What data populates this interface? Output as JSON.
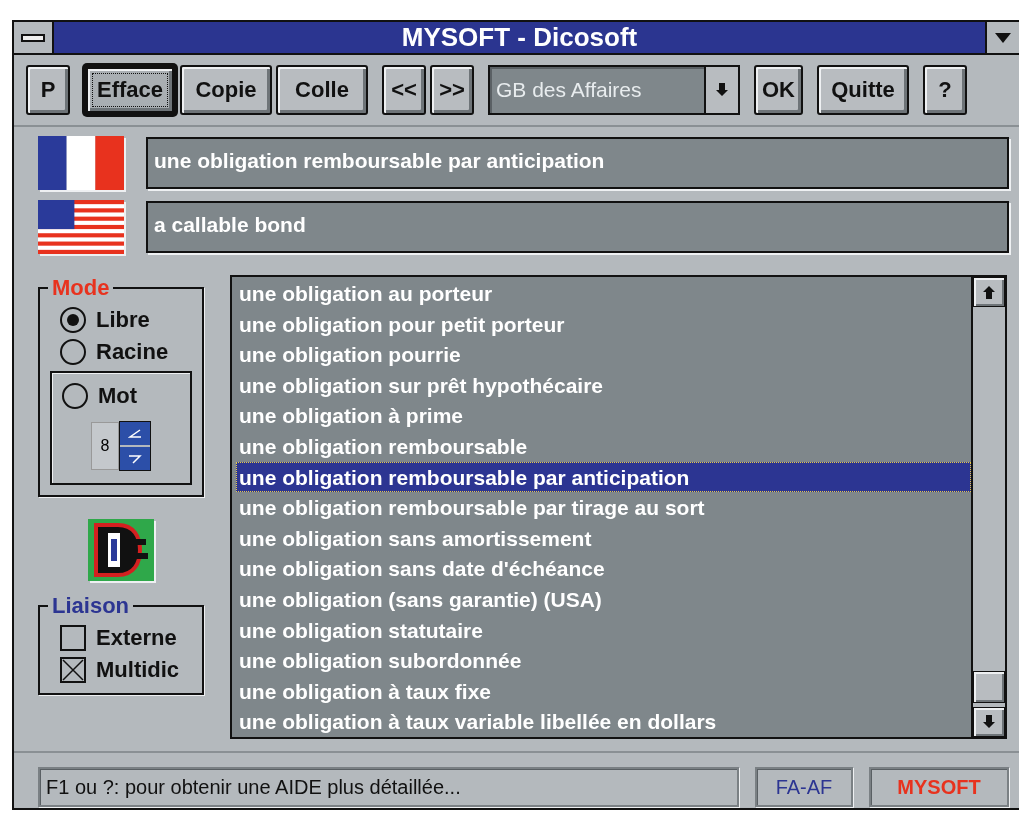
{
  "window": {
    "title": "MYSOFT - Dicosoft"
  },
  "toolbar": [
    {
      "kind": "button",
      "label": "P",
      "focused": false
    },
    {
      "kind": "button",
      "label": "Efface",
      "focused": true
    },
    {
      "kind": "button",
      "label": "Copie",
      "focused": false
    },
    {
      "kind": "button",
      "label": "Colle",
      "focused": false
    },
    {
      "kind": "button",
      "label": "<<",
      "focused": false
    },
    {
      "kind": "button",
      "label": ">>",
      "focused": false
    },
    {
      "kind": "select",
      "value": "GB des Affaires"
    },
    {
      "kind": "button",
      "label": "OK",
      "focused": false
    },
    {
      "kind": "button",
      "label": "Quitte",
      "focused": false
    },
    {
      "kind": "button",
      "label": "?",
      "focused": false
    }
  ],
  "translations": [
    {
      "kind": "french",
      "text": "une obligation remboursable par anticipation"
    },
    {
      "kind": "american",
      "text": "a callable bond"
    }
  ],
  "mode": {
    "title": "Mode",
    "options": [
      {
        "label": "Libre",
        "selected": true
      },
      {
        "label": "Racine",
        "selected": false
      },
      {
        "label": "Mot",
        "selected": false
      }
    ],
    "word_count": "8"
  },
  "liaison": {
    "title": "Liaison",
    "options": [
      {
        "label": "Externe",
        "checked": false
      },
      {
        "label": "Multidic",
        "checked": true
      }
    ]
  },
  "results": [
    {
      "text": "une obligation au porteur",
      "selected": false
    },
    {
      "text": "une obligation pour petit porteur",
      "selected": false
    },
    {
      "text": "une obligation pourrie",
      "selected": false
    },
    {
      "text": "une obligation sur prêt hypothécaire",
      "selected": false
    },
    {
      "text": "une obligation à prime",
      "selected": false
    },
    {
      "text": "une obligation remboursable",
      "selected": false
    },
    {
      "text": "une obligation remboursable par anticipation",
      "selected": true
    },
    {
      "text": "une obligation remboursable par tirage au sort",
      "selected": false
    },
    {
      "text": "une obligation sans amortissement",
      "selected": false
    },
    {
      "text": "une obligation sans date d'échéance",
      "selected": false
    },
    {
      "text": "une obligation (sans garantie) (USA)",
      "selected": false
    },
    {
      "text": "une obligation statutaire",
      "selected": false
    },
    {
      "text": "une obligation subordonnée",
      "selected": false
    },
    {
      "text": "une obligation à taux fixe",
      "selected": false
    },
    {
      "text": "une obligation à taux variable libellée en dollars",
      "selected": false
    }
  ],
  "status_bar": {
    "message": "F1 ou ?: pour obtenir une AIDE plus détaillée...",
    "code": "FA-AF",
    "brand": "MYSOFT"
  }
}
